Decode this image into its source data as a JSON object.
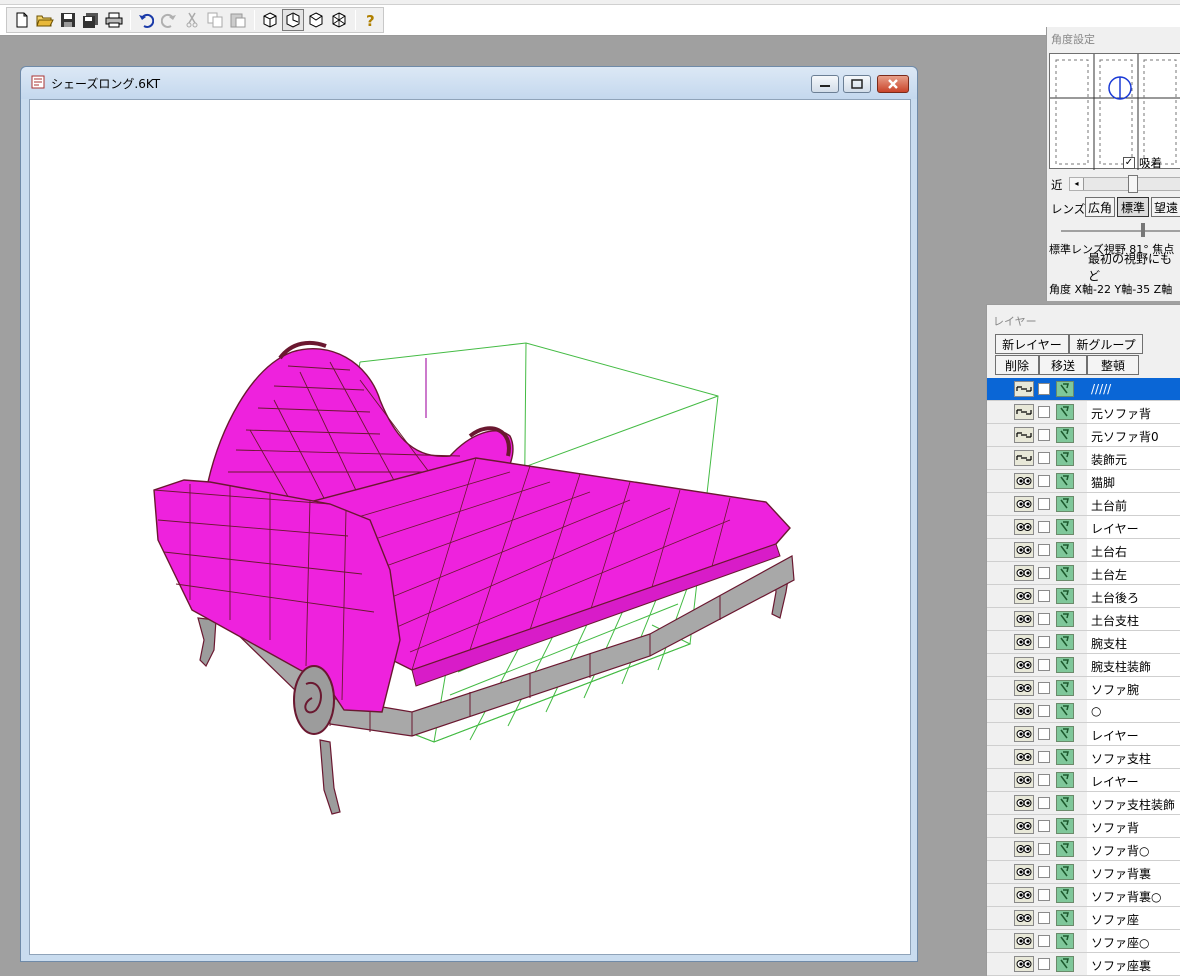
{
  "toolbar": {
    "buttons": [
      "new-file-icon",
      "open-folder-icon",
      "save-icon",
      "save-all-icon",
      "print-icon",
      "sep",
      "undo-icon",
      "redo-icon",
      "cut-icon",
      "copy-icon",
      "paste-icon",
      "sep",
      "view-perspective-icon",
      "view-front-icon",
      "view-side-icon",
      "view-top-icon",
      "sep",
      "help-icon"
    ]
  },
  "document": {
    "title": "シェーズロング.6KT"
  },
  "angle_panel": {
    "title": "角度設定",
    "snap_label": "吸着",
    "snap_checked": true,
    "near_label": "近",
    "lens_label": "レンズ",
    "lens_buttons": [
      "広角",
      "標準",
      "望遠"
    ],
    "lens_info": "標準レンズ視野 81° 焦点",
    "reset_view": "最初の視野にもど",
    "angle_readout": "角度 X軸-22 Y軸-35 Z軸"
  },
  "layer_panel": {
    "title": "レイヤー",
    "buttons_row1": [
      "新レイヤー",
      "新グループ"
    ],
    "buttons_row2": [
      "削除",
      "移送",
      "整頓"
    ],
    "layers": [
      {
        "name": "/////",
        "vis": "link",
        "selected": true
      },
      {
        "name": "元ソファ背",
        "vis": "link"
      },
      {
        "name": "元ソファ背0",
        "vis": "link"
      },
      {
        "name": "装飾元",
        "vis": "link"
      },
      {
        "name": "猫脚",
        "vis": "eye"
      },
      {
        "name": "土台前",
        "vis": "eye"
      },
      {
        "name": "レイヤー",
        "vis": "eye"
      },
      {
        "name": "土台右",
        "vis": "eye"
      },
      {
        "name": "土台左",
        "vis": "eye"
      },
      {
        "name": "土台後ろ",
        "vis": "eye"
      },
      {
        "name": "土台支柱",
        "vis": "eye"
      },
      {
        "name": "腕支柱",
        "vis": "eye"
      },
      {
        "name": "腕支柱装飾",
        "vis": "eye"
      },
      {
        "name": "ソファ腕",
        "vis": "eye"
      },
      {
        "name": "○",
        "vis": "eye"
      },
      {
        "name": "レイヤー",
        "vis": "eye"
      },
      {
        "name": "ソファ支柱",
        "vis": "eye"
      },
      {
        "name": "レイヤー",
        "vis": "eye"
      },
      {
        "name": "ソファ支柱装飾",
        "vis": "eye"
      },
      {
        "name": "ソファ背",
        "vis": "eye"
      },
      {
        "name": "ソファ背○",
        "vis": "eye"
      },
      {
        "name": "ソファ背裏",
        "vis": "eye"
      },
      {
        "name": "ソファ背裏○",
        "vis": "eye"
      },
      {
        "name": "ソファ座",
        "vis": "eye"
      },
      {
        "name": "ソファ座○",
        "vis": "eye"
      },
      {
        "name": "ソファ座裏",
        "vis": "eye"
      }
    ]
  },
  "colors": {
    "model_fill": "#ee22dd",
    "model_wire": "#6a1830",
    "base_gray": "#a8a8a8",
    "bbox_line": "#44bb44",
    "selection": "#0a66d6"
  }
}
